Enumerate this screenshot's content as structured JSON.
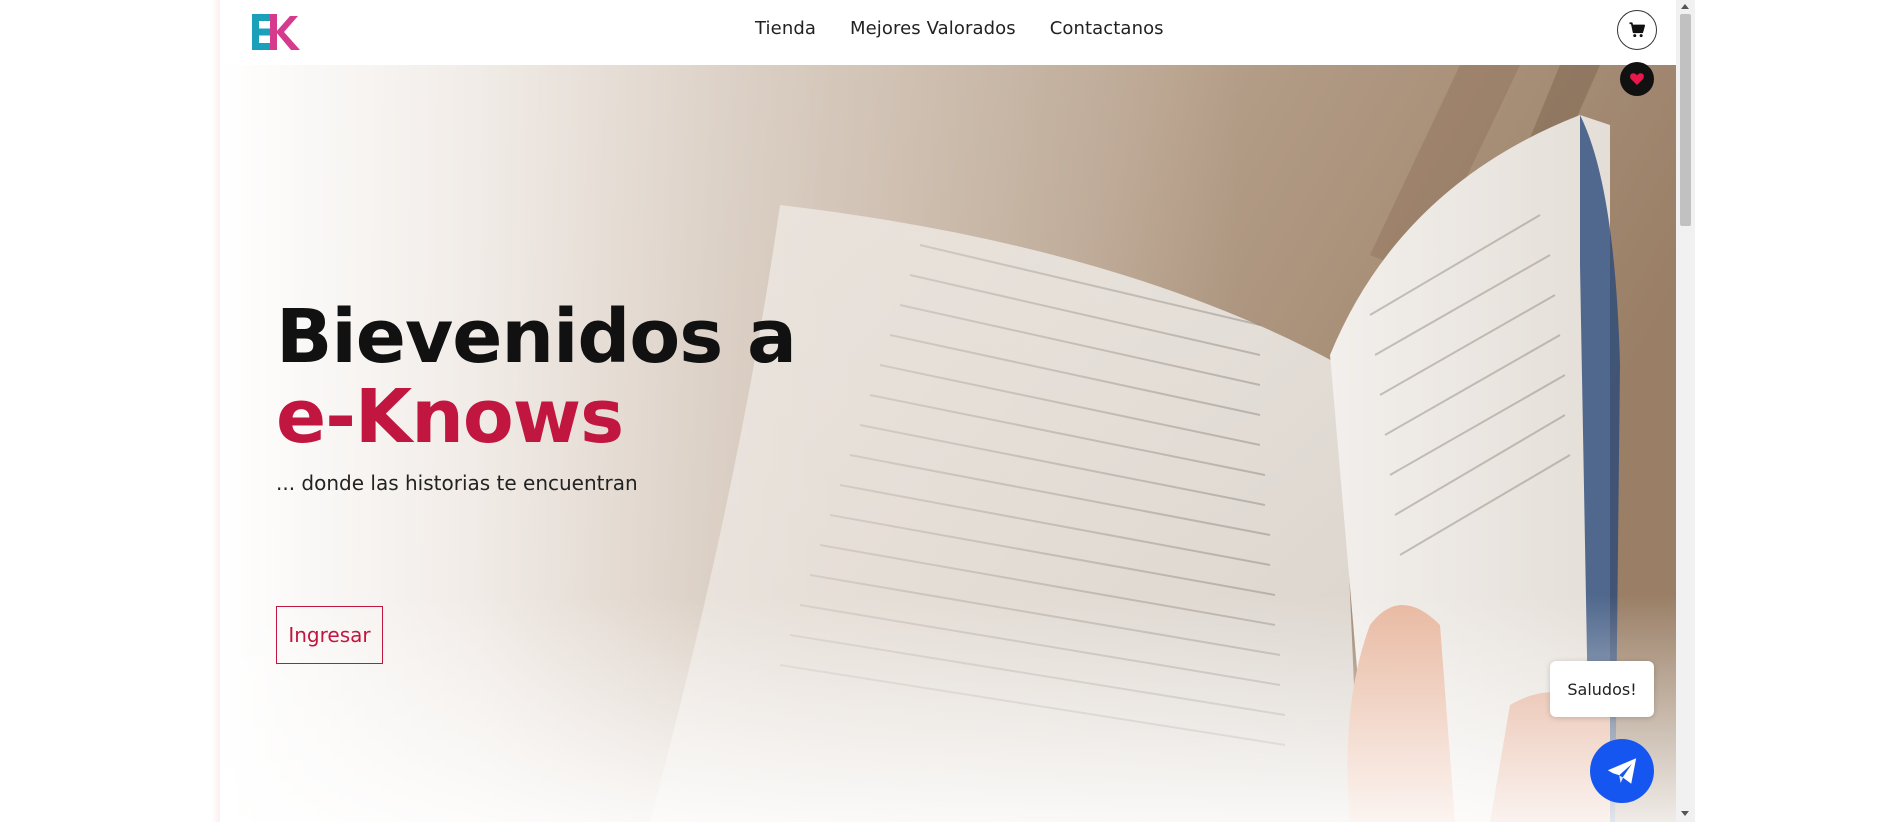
{
  "brand": {
    "logo_text": "EK",
    "colors": {
      "teal": "#1aa0b8",
      "pink": "#d63a8c",
      "accent": "#c0163f",
      "chat_blue": "#1556f0"
    }
  },
  "nav": {
    "links": [
      "Tienda",
      "Mejores Valorados",
      "Contactanos"
    ],
    "cart_icon": "shopping-cart-icon",
    "favorites_icon": "heart-icon"
  },
  "hero": {
    "title_line1": "Bievenidos a",
    "title_line2": "e-Knows",
    "tagline": "... donde las historias te encuentran",
    "cta_label": "Ingresar",
    "background": "open-book-photo"
  },
  "chat": {
    "bubble_text": "Saludos!",
    "button_icon": "paper-plane-icon"
  }
}
